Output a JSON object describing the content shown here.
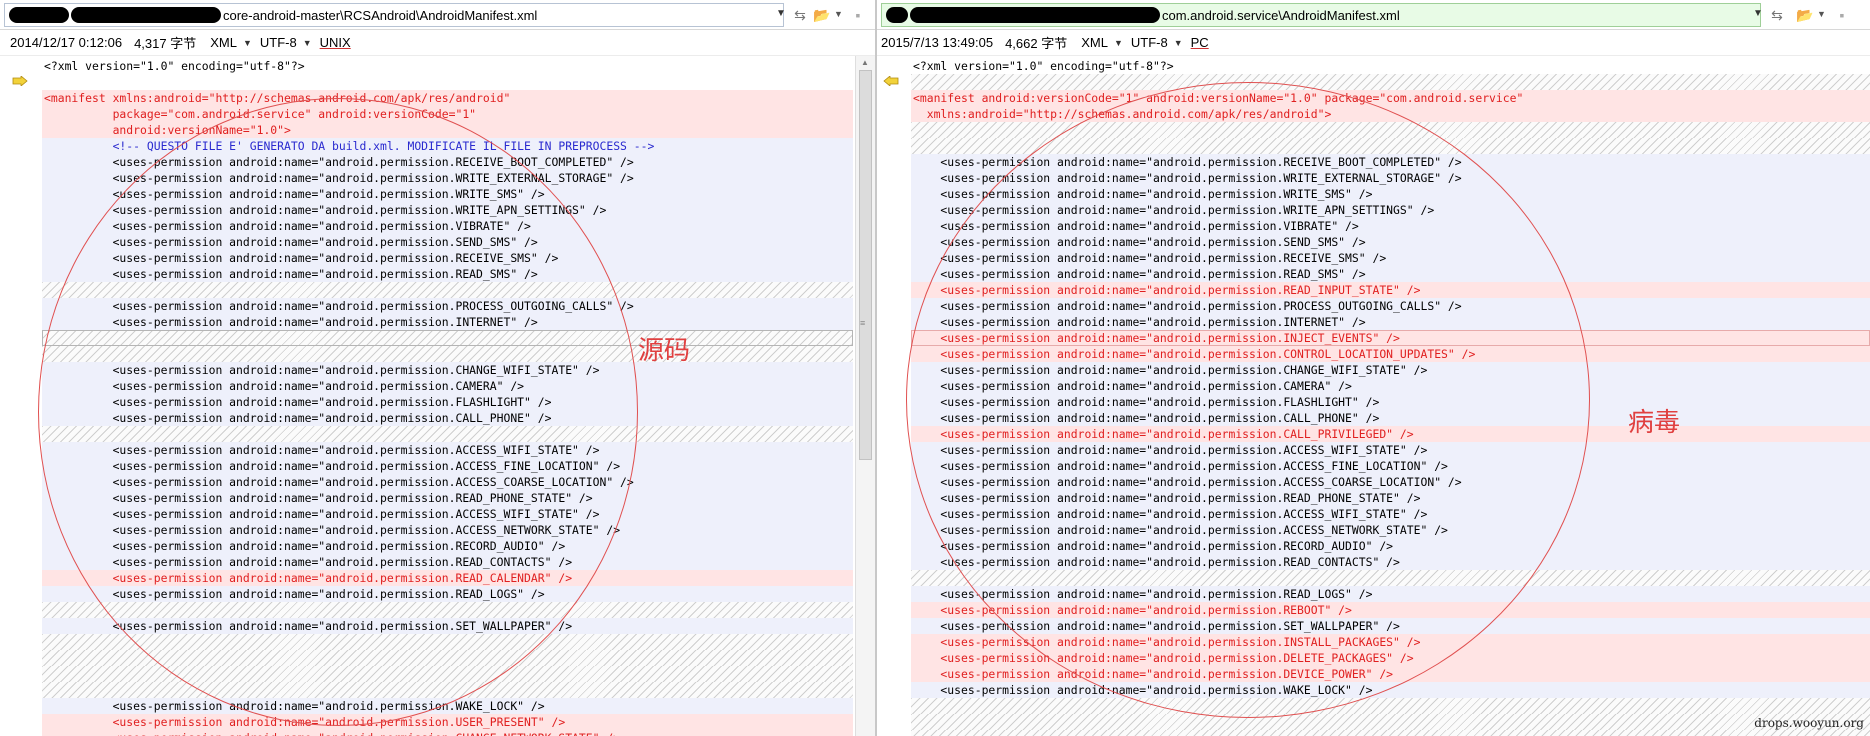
{
  "left": {
    "path_redacted_width": 218,
    "path_visible": "core-android-master\\RCSAndroid\\AndroidManifest.xml",
    "timestamp": "2014/12/17 0:12:06",
    "size": "4,317 字节",
    "format": "XML",
    "encoding": "UTF-8",
    "line_ending": "UNIX"
  },
  "right": {
    "path_visible": "com.android.service\\AndroidManifest.xml",
    "timestamp": "2015/7/13 13:49:05",
    "size": "4,662 字节",
    "format": "XML",
    "encoding": "UTF-8",
    "line_ending": "PC"
  },
  "common_lines": {
    "decl_prefix": "<?xml version=",
    "decl_version": "\"1.0\"",
    "decl_mid": " encoding=",
    "decl_encoding": "\"utf-8\"",
    "decl_suffix": "?>"
  },
  "left_lines": [
    {
      "type": "plain",
      "text": "<?xml version=\"1.0\" encoding=\"utf-8\"?>",
      "kind": "decl"
    },
    {
      "type": "plain",
      "text": ""
    },
    {
      "type": "changed",
      "text": "<manifest xmlns:android=\"http://schemas.android.com/apk/res/android\""
    },
    {
      "type": "changed",
      "text": "          package=\"com.android.service\" android:versionCode=\"1\""
    },
    {
      "type": "changed",
      "text": "          android:versionName=\"1.0\">"
    },
    {
      "type": "normal",
      "text": "          <!-- QUESTO FILE E' GENERATO DA build.xml. MODIFICATE IL FILE IN PREPROCESS -->",
      "kind": "comment"
    },
    {
      "type": "normal",
      "text": "          <uses-permission android:name=\"android.permission.RECEIVE_BOOT_COMPLETED\" />"
    },
    {
      "type": "normal",
      "text": "          <uses-permission android:name=\"android.permission.WRITE_EXTERNAL_STORAGE\" />"
    },
    {
      "type": "normal",
      "text": "          <uses-permission android:name=\"android.permission.WRITE_SMS\" />"
    },
    {
      "type": "normal",
      "text": "          <uses-permission android:name=\"android.permission.WRITE_APN_SETTINGS\" />"
    },
    {
      "type": "normal",
      "text": "          <uses-permission android:name=\"android.permission.VIBRATE\" />"
    },
    {
      "type": "normal",
      "text": "          <uses-permission android:name=\"android.permission.SEND_SMS\" />"
    },
    {
      "type": "normal",
      "text": "          <uses-permission android:name=\"android.permission.RECEIVE_SMS\" />"
    },
    {
      "type": "normal",
      "text": "          <uses-permission android:name=\"android.permission.READ_SMS\" />"
    },
    {
      "type": "blank",
      "text": ""
    },
    {
      "type": "normal",
      "text": "          <uses-permission android:name=\"android.permission.PROCESS_OUTGOING_CALLS\" />"
    },
    {
      "type": "normal",
      "text": "          <uses-permission android:name=\"android.permission.INTERNET\" />"
    },
    {
      "type": "blank",
      "text": "",
      "boxed": true
    },
    {
      "type": "blank",
      "text": ""
    },
    {
      "type": "normal",
      "text": "          <uses-permission android:name=\"android.permission.CHANGE_WIFI_STATE\" />"
    },
    {
      "type": "normal",
      "text": "          <uses-permission android:name=\"android.permission.CAMERA\" />"
    },
    {
      "type": "normal",
      "text": "          <uses-permission android:name=\"android.permission.FLASHLIGHT\" />"
    },
    {
      "type": "normal",
      "text": "          <uses-permission android:name=\"android.permission.CALL_PHONE\" />"
    },
    {
      "type": "blank",
      "text": ""
    },
    {
      "type": "normal",
      "text": "          <uses-permission android:name=\"android.permission.ACCESS_WIFI_STATE\" />"
    },
    {
      "type": "normal",
      "text": "          <uses-permission android:name=\"android.permission.ACCESS_FINE_LOCATION\" />"
    },
    {
      "type": "normal",
      "text": "          <uses-permission android:name=\"android.permission.ACCESS_COARSE_LOCATION\" />"
    },
    {
      "type": "normal",
      "text": "          <uses-permission android:name=\"android.permission.READ_PHONE_STATE\" />"
    },
    {
      "type": "normal",
      "text": "          <uses-permission android:name=\"android.permission.ACCESS_WIFI_STATE\" />"
    },
    {
      "type": "normal",
      "text": "          <uses-permission android:name=\"android.permission.ACCESS_NETWORK_STATE\" />"
    },
    {
      "type": "normal",
      "text": "          <uses-permission android:name=\"android.permission.RECORD_AUDIO\" />"
    },
    {
      "type": "normal",
      "text": "          <uses-permission android:name=\"android.permission.READ_CONTACTS\" />"
    },
    {
      "type": "changed",
      "text": "          <uses-permission android:name=\"android.permission.READ_CALENDAR\" />"
    },
    {
      "type": "normal",
      "text": "          <uses-permission android:name=\"android.permission.READ_LOGS\" />"
    },
    {
      "type": "blank",
      "text": ""
    },
    {
      "type": "normal",
      "text": "          <uses-permission android:name=\"android.permission.SET_WALLPAPER\" />"
    },
    {
      "type": "blank",
      "text": ""
    },
    {
      "type": "blank",
      "text": ""
    },
    {
      "type": "blank",
      "text": ""
    },
    {
      "type": "blank",
      "text": ""
    },
    {
      "type": "normal",
      "text": "          <uses-permission android:name=\"android.permission.WAKE_LOCK\" />"
    },
    {
      "type": "changed",
      "text": "          <uses-permission android:name=\"android.permission.USER_PRESENT\" />"
    },
    {
      "type": "changed",
      "text": "          <uses-permission android:name=\"android.permission.CHANGE_NETWORK_STATE\" />"
    }
  ],
  "right_lines": [
    {
      "type": "plain",
      "text": "<?xml version=\"1.0\" encoding=\"utf-8\"?>",
      "kind": "decl"
    },
    {
      "type": "blank",
      "text": ""
    },
    {
      "type": "changed",
      "text": "<manifest android:versionCode=\"1\" android:versionName=\"1.0\" package=\"com.android.service\"",
      "kind": "hdr"
    },
    {
      "type": "changed",
      "text": "  xmlns:android=\"http://schemas.android.com/apk/res/android\">",
      "kind": "hdr"
    },
    {
      "type": "blank",
      "text": ""
    },
    {
      "type": "blank",
      "text": ""
    },
    {
      "type": "normal",
      "text": "    <uses-permission android:name=\"android.permission.RECEIVE_BOOT_COMPLETED\" />"
    },
    {
      "type": "normal",
      "text": "    <uses-permission android:name=\"android.permission.WRITE_EXTERNAL_STORAGE\" />"
    },
    {
      "type": "normal",
      "text": "    <uses-permission android:name=\"android.permission.WRITE_SMS\" />"
    },
    {
      "type": "normal",
      "text": "    <uses-permission android:name=\"android.permission.WRITE_APN_SETTINGS\" />"
    },
    {
      "type": "normal",
      "text": "    <uses-permission android:name=\"android.permission.VIBRATE\" />"
    },
    {
      "type": "normal",
      "text": "    <uses-permission android:name=\"android.permission.SEND_SMS\" />"
    },
    {
      "type": "normal",
      "text": "    <uses-permission android:name=\"android.permission.RECEIVE_SMS\" />"
    },
    {
      "type": "normal",
      "text": "    <uses-permission android:name=\"android.permission.READ_SMS\" />"
    },
    {
      "type": "changed",
      "text": "    <uses-permission android:name=\"android.permission.READ_INPUT_STATE\" />"
    },
    {
      "type": "normal",
      "text": "    <uses-permission android:name=\"android.permission.PROCESS_OUTGOING_CALLS\" />"
    },
    {
      "type": "normal",
      "text": "    <uses-permission android:name=\"android.permission.INTERNET\" />"
    },
    {
      "type": "changed",
      "text": "    <uses-permission android:name=\"android.permission.INJECT_EVENTS\" />",
      "boxed": true
    },
    {
      "type": "changed",
      "text": "    <uses-permission android:name=\"android.permission.CONTROL_LOCATION_UPDATES\" />"
    },
    {
      "type": "normal",
      "text": "    <uses-permission android:name=\"android.permission.CHANGE_WIFI_STATE\" />"
    },
    {
      "type": "normal",
      "text": "    <uses-permission android:name=\"android.permission.CAMERA\" />"
    },
    {
      "type": "normal",
      "text": "    <uses-permission android:name=\"android.permission.FLASHLIGHT\" />"
    },
    {
      "type": "normal",
      "text": "    <uses-permission android:name=\"android.permission.CALL_PHONE\" />"
    },
    {
      "type": "changed",
      "text": "    <uses-permission android:name=\"android.permission.CALL_PRIVILEGED\" />"
    },
    {
      "type": "normal",
      "text": "    <uses-permission android:name=\"android.permission.ACCESS_WIFI_STATE\" />"
    },
    {
      "type": "normal",
      "text": "    <uses-permission android:name=\"android.permission.ACCESS_FINE_LOCATION\" />"
    },
    {
      "type": "normal",
      "text": "    <uses-permission android:name=\"android.permission.ACCESS_COARSE_LOCATION\" />"
    },
    {
      "type": "normal",
      "text": "    <uses-permission android:name=\"android.permission.READ_PHONE_STATE\" />"
    },
    {
      "type": "normal",
      "text": "    <uses-permission android:name=\"android.permission.ACCESS_WIFI_STATE\" />"
    },
    {
      "type": "normal",
      "text": "    <uses-permission android:name=\"android.permission.ACCESS_NETWORK_STATE\" />"
    },
    {
      "type": "normal",
      "text": "    <uses-permission android:name=\"android.permission.RECORD_AUDIO\" />"
    },
    {
      "type": "normal",
      "text": "    <uses-permission android:name=\"android.permission.READ_CONTACTS\" />"
    },
    {
      "type": "blank",
      "text": ""
    },
    {
      "type": "normal",
      "text": "    <uses-permission android:name=\"android.permission.READ_LOGS\" />"
    },
    {
      "type": "changed",
      "text": "    <uses-permission android:name=\"android.permission.REBOOT\" />"
    },
    {
      "type": "normal",
      "text": "    <uses-permission android:name=\"android.permission.SET_WALLPAPER\" />"
    },
    {
      "type": "changed",
      "text": "    <uses-permission android:name=\"android.permission.INSTALL_PACKAGES\" />"
    },
    {
      "type": "changed",
      "text": "    <uses-permission android:name=\"android.permission.DELETE_PACKAGES\" />"
    },
    {
      "type": "changed",
      "text": "    <uses-permission android:name=\"android.permission.DEVICE_POWER\" />"
    },
    {
      "type": "normal",
      "text": "    <uses-permission android:name=\"android.permission.WAKE_LOCK\" />"
    },
    {
      "type": "blank",
      "text": ""
    },
    {
      "type": "blank",
      "text": ""
    },
    {
      "type": "blank",
      "text": ""
    }
  ],
  "annotations": {
    "left_label": "源码",
    "right_label": "病毒"
  },
  "watermark": "drops.wooyun.org",
  "colors": {
    "changed_bg": "#ffe4e4",
    "changed_text": "#e02020",
    "normal_bg": "#eef0fb",
    "annotation": "#e04040"
  }
}
